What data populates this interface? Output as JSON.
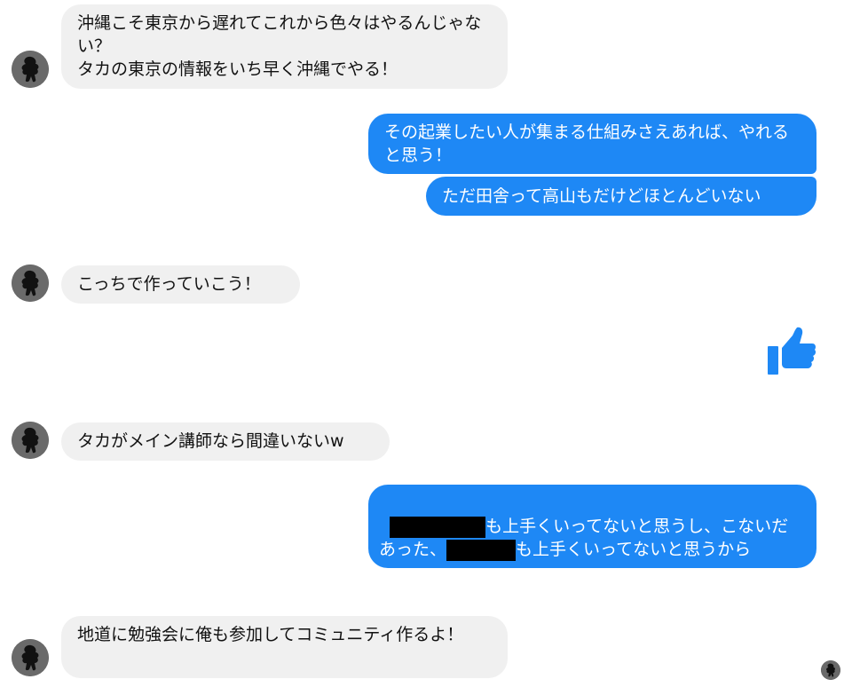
{
  "conversation": {
    "messages": [
      {
        "dir": "in",
        "text": "沖縄こそ東京から遅れてこれから色々はやるんじゃない？\nタカの東京の情報をいち早く沖縄でやる！"
      },
      {
        "dir": "out",
        "text": "その起業したい人が集まる仕組みさえあれば、やれると思う！"
      },
      {
        "dir": "out",
        "text": "ただ田舎って高山もだけどほとんどいない"
      },
      {
        "dir": "in",
        "text": "こっちで作っていこう！"
      },
      {
        "dir": "out",
        "type": "like",
        "icon": "thumbs-up-icon"
      },
      {
        "dir": "in",
        "text": "タカがメイン講師なら間違いないw"
      },
      {
        "dir": "out",
        "text_part1": "も上手くいってないと思うし、こないだあった、",
        "text_part2": "も上手くいってないと思うから"
      },
      {
        "dir": "in",
        "text": "地道に勉強会に俺も参加してコミュニティ作るよ！"
      }
    ]
  },
  "colors": {
    "outgoing_bubble": "#1e88f5",
    "incoming_bubble": "#f0f0f0",
    "like_icon": "#1e88f5"
  }
}
